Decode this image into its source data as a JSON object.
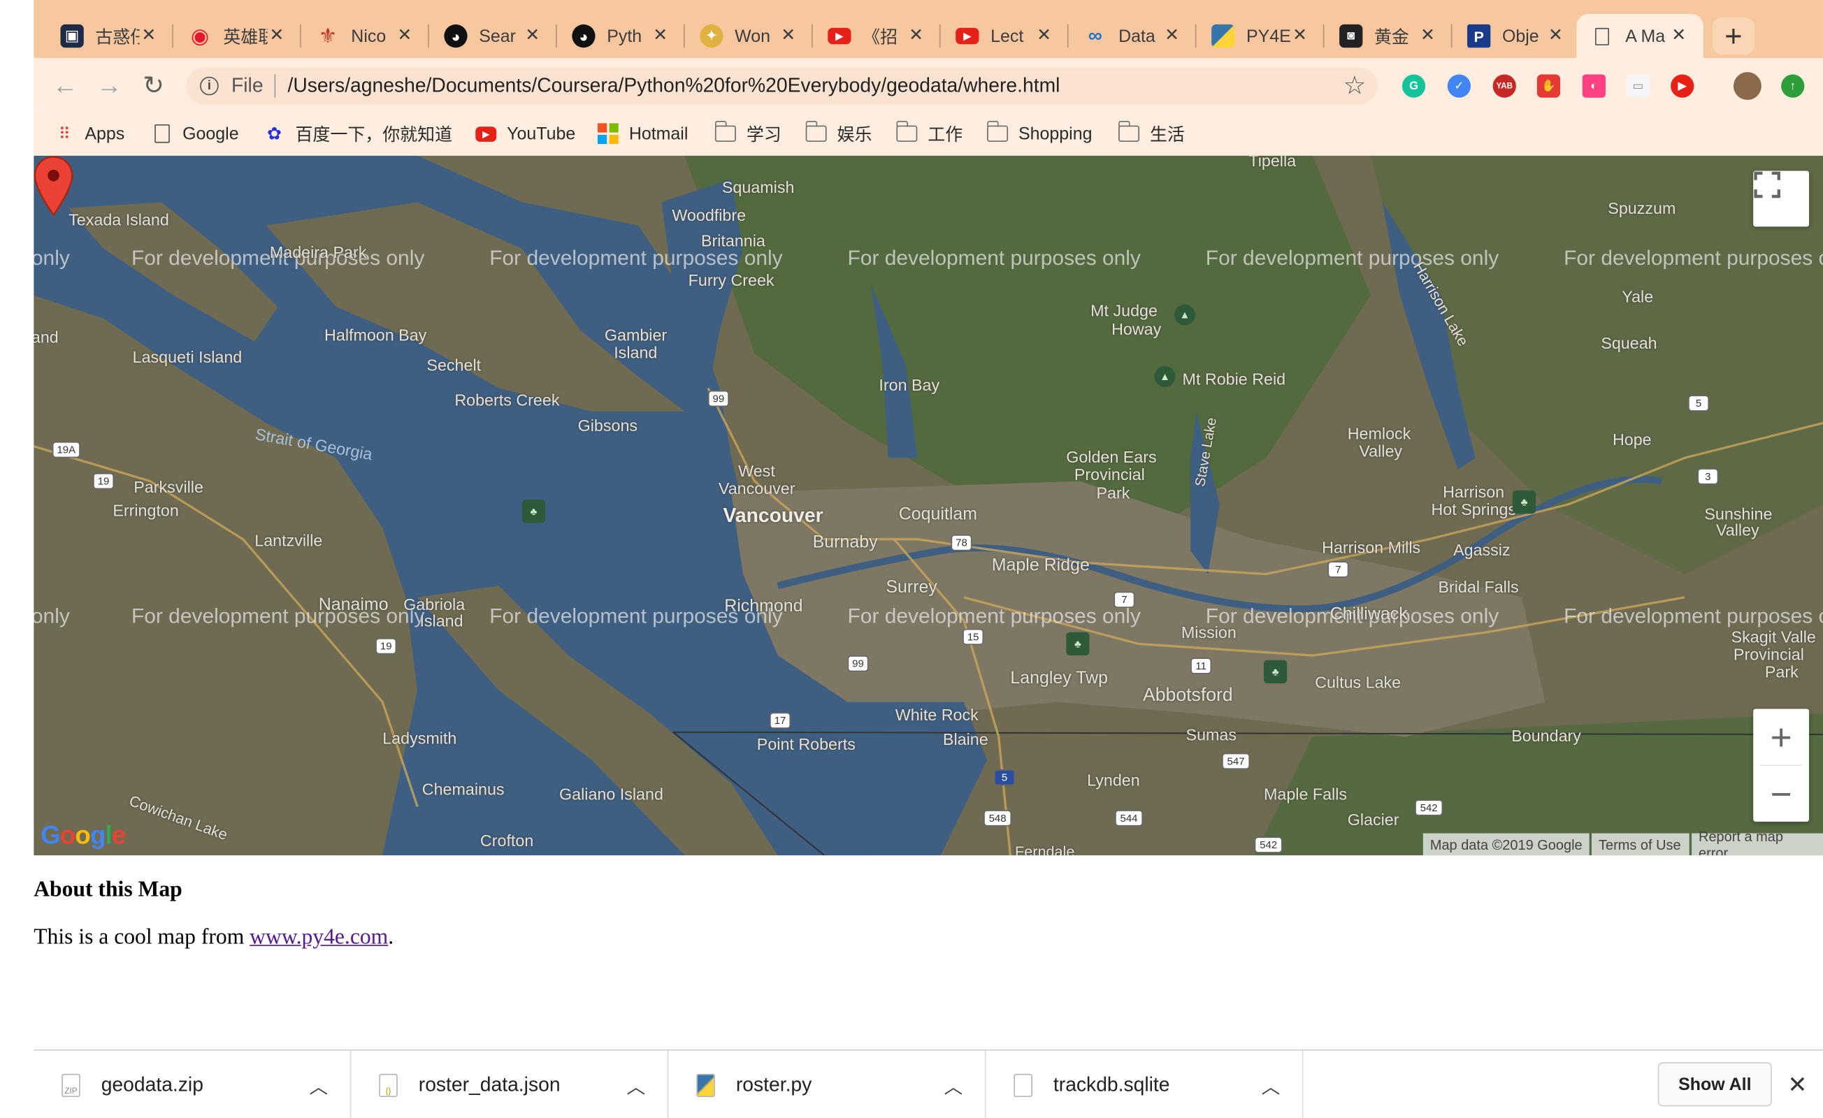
{
  "tabs": [
    {
      "title": "古惑仔",
      "icon": "game-controller-icon",
      "color": "#1f2a44"
    },
    {
      "title": "英雄联",
      "icon": "weibo-icon",
      "color": "#e6162d"
    },
    {
      "title": "Nico",
      "icon": "fleur-icon",
      "color": "#c0392b"
    },
    {
      "title": "Sear",
      "icon": "github-icon",
      "color": "#111111"
    },
    {
      "title": "Pyth",
      "icon": "github-icon",
      "color": "#111111"
    },
    {
      "title": "Won",
      "icon": "pin-icon",
      "color": "#e0b341"
    },
    {
      "title": "《招",
      "icon": "youtube-icon",
      "color": "#e62117"
    },
    {
      "title": "Lect",
      "icon": "youtube-icon",
      "color": "#e62117"
    },
    {
      "title": "Data",
      "icon": "coursera-icon",
      "color": "#2a73cc"
    },
    {
      "title": "PY4E",
      "icon": "python-icon",
      "color": "#3776ab"
    },
    {
      "title": "黄金",
      "icon": "vintage-icon",
      "color": "#222222"
    },
    {
      "title": "Obje",
      "icon": "p-icon",
      "color": "#1a3a8a"
    },
    {
      "title": "A Ma",
      "icon": "page-icon",
      "color": "#555555",
      "active": true
    }
  ],
  "toolbar": {
    "file_label": "File",
    "url": "/Users/agneshe/Documents/Coursera/Python%20for%20Everybody/geodata/where.html"
  },
  "bookmarks": [
    {
      "label": "Apps",
      "icon": "apps-grid-icon"
    },
    {
      "label": "Google",
      "icon": "page-icon"
    },
    {
      "label": "百度一下，你就知道",
      "icon": "baidu-paw-icon"
    },
    {
      "label": "YouTube",
      "icon": "youtube-icon"
    },
    {
      "label": "Hotmail",
      "icon": "windows-icon"
    },
    {
      "label": "学习",
      "icon": "folder-icon"
    },
    {
      "label": "娱乐",
      "icon": "folder-icon"
    },
    {
      "label": "工作",
      "icon": "folder-icon"
    },
    {
      "label": "Shopping",
      "icon": "folder-icon"
    },
    {
      "label": "生活",
      "icon": "folder-icon"
    }
  ],
  "map": {
    "watermark": "For development purposes only",
    "labels": {
      "tipella": "Tipella",
      "squamish": "Squamish",
      "texada": "Texada Island",
      "woodfibre": "Woodfibre",
      "spuzzum": "Spuzzum",
      "britannia": "Britannia",
      "madeira": "Madeira Park",
      "furry": "Furry Creek",
      "harrison_lake": "Harrison Lake",
      "yale": "Yale",
      "mt_judge": "Mt Judge",
      "howay": "Howay",
      "halfmoon": "Halfmoon Bay",
      "gambier": "Gambier",
      "gambier2": "Island",
      "squeah": "Squeah",
      "lasqueti": "Lasqueti Island",
      "sechelt": "Sechelt",
      "mt_robie": "Mt Robie Reid",
      "iron_bay": "Iron Bay",
      "roberts": "Roberts Creek",
      "gibsons": "Gibsons",
      "hemlock": "Hemlock",
      "valley": "Valley",
      "hope": "Hope",
      "stave": "Stave Lake",
      "strait": "Strait of Georgia",
      "golden_ears": "Golden Ears",
      "provincial": "Provincial",
      "park": "Park",
      "parksville": "Parksville",
      "west_vancouver": "West",
      "west_vancouver2": "Vancouver",
      "errington": "Errington",
      "harrison_hot": "Harrison",
      "harrison_hot2": "Hot Springs",
      "sunshine": "Sunshine",
      "sunshine2": "Valley",
      "vancouver": "Vancouver",
      "coquitlam": "Coquitlam",
      "burnaby": "Burnaby",
      "lantzville": "Lantzville",
      "harrison_mills": "Harrison Mills",
      "agassiz": "Agassiz",
      "maple_ridge": "Maple Ridge",
      "bridal": "Bridal Falls",
      "surrey": "Surrey",
      "nanaimo": "Nanaimo",
      "gabriola": "Gabriola",
      "gabriola2": "Island",
      "richmond": "Richmond",
      "mission": "Mission",
      "chilliwack": "Chilliwack",
      "skagit": "Skagit Valle",
      "skagit2": "Provincial",
      "skagit3": "Park",
      "langley": "Langley Twp",
      "abbotsford": "Abbotsford",
      "cultus": "Cultus Lake",
      "white_rock": "White Rock",
      "ladysmith": "Ladysmith",
      "point_roberts": "Point Roberts",
      "blaine": "Blaine",
      "sumas": "Sumas",
      "boundary": "Boundary",
      "chemainus": "Chemainus",
      "galiano": "Galiano Island",
      "lynden": "Lynden",
      "maple_falls": "Maple Falls",
      "glacier": "Glacier",
      "crofton": "Crofton",
      "cowichan": "Cowichan Lake",
      "ferndale": "Ferndale",
      "iand": "and"
    },
    "routes": [
      "99",
      "19A",
      "19",
      "78",
      "7",
      "15",
      "99",
      "11",
      "17",
      "5",
      "548",
      "544",
      "542",
      "542",
      "547",
      "3",
      "5",
      "7",
      "19"
    ],
    "zoom_in": "+",
    "zoom_out": "−",
    "attribution": {
      "map_data": "Map data ©2019 Google",
      "terms": "Terms of Use",
      "report": "Report a map error"
    },
    "google_logo": "Google"
  },
  "content": {
    "heading": "About this Map",
    "text_before": "This is a cool map from ",
    "link": "www.py4e.com",
    "text_after": "."
  },
  "downloads": [
    {
      "name": "geodata.zip",
      "icon": "zip-file-icon"
    },
    {
      "name": "roster_data.json",
      "icon": "json-file-icon"
    },
    {
      "name": "roster.py",
      "icon": "python-file-icon"
    },
    {
      "name": "trackdb.sqlite",
      "icon": "file-icon"
    }
  ],
  "download_bar": {
    "show_all": "Show All"
  },
  "colors": {
    "tabstrip": "#f7c7a0",
    "toolbar": "#ffeee0",
    "water": "#3e5f82",
    "land": "#7a6f5a",
    "link": "#551a8b"
  }
}
